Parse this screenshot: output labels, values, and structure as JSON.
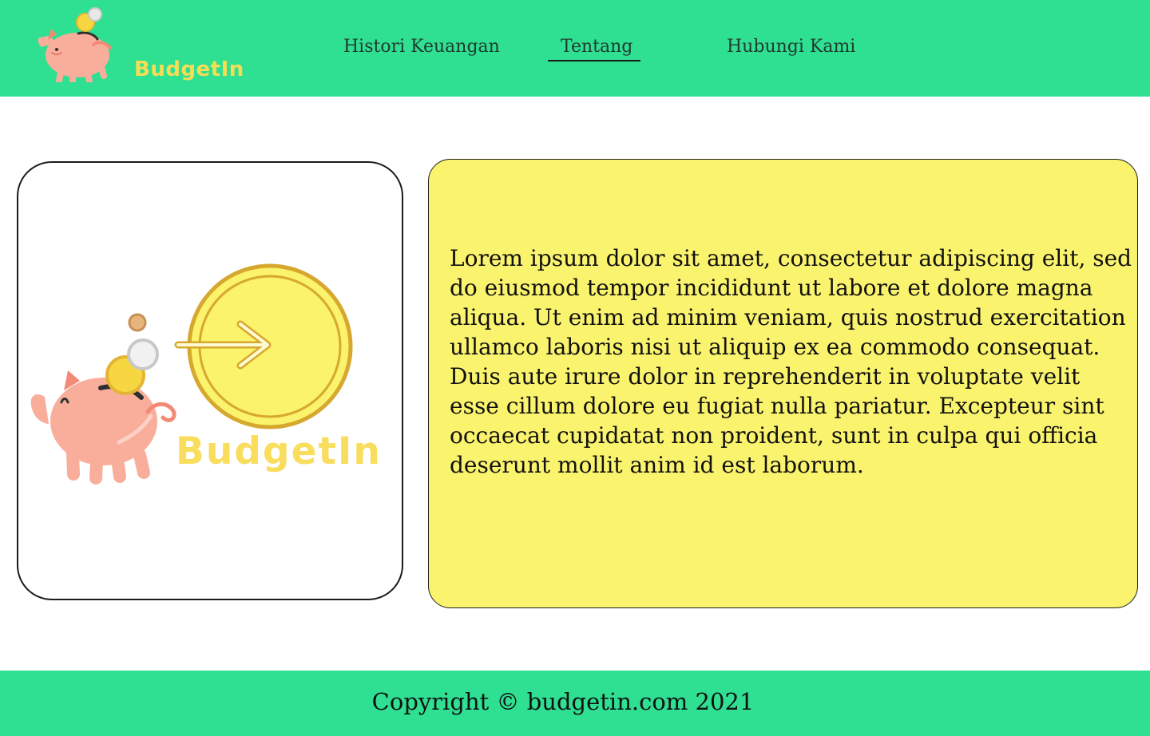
{
  "brand": {
    "name": "BudgetIn",
    "colors": {
      "primary": "#2fdf92",
      "panel": "#faf36d",
      "logo_text": "#f7dd53",
      "pig": "#f8ad9b",
      "coin": "#f6d742"
    }
  },
  "nav": {
    "items": [
      {
        "label": "Histori Keuangan",
        "active": false
      },
      {
        "label": "Tentang",
        "active": true
      },
      {
        "label": "Hubungi Kami",
        "active": false
      }
    ]
  },
  "about": {
    "image_logo_text": "BudgetIn",
    "body": "Lorem ipsum dolor sit amet, consectetur adipiscing elit, sed do eiusmod tempor incididunt ut labore et dolore magna aliqua. Ut enim ad minim veniam, quis nostrud exercitation ullamco laboris nisi ut aliquip ex ea commodo consequat. Duis aute irure dolor in reprehenderit in voluptate velit esse cillum dolore eu fugiat nulla pariatur. Excepteur sint occaecat cupidatat non proident, sunt in culpa qui officia deserunt mollit anim id est laborum."
  },
  "footer": {
    "copyright": "Copyright © budgetin.com 2021"
  },
  "icons": {
    "header_logo": "piggy-bank-logo-icon",
    "about_image": "budgetin-login-coin-icon"
  }
}
